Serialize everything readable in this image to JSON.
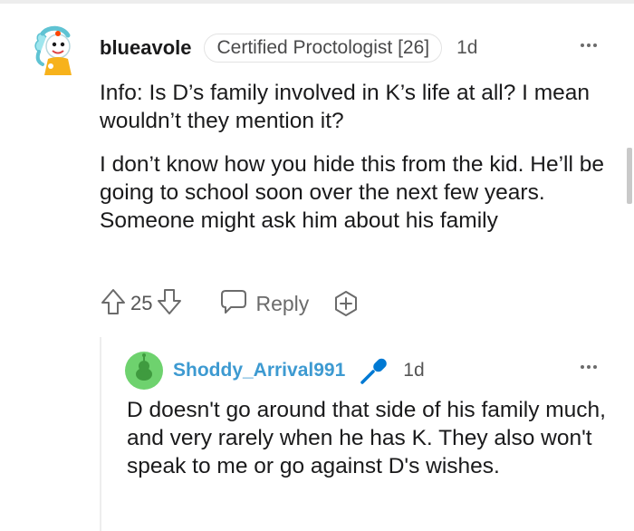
{
  "comment": {
    "username": "blueavole",
    "flair": "Certified Proctologist [26]",
    "time": "1d",
    "paragraphs": [
      "Info: Is D’s family involved in K’s life at all? I mean wouldn’t they mention it?",
      "I don’t know how you hide this from the kid. He’ll be going to school soon over the next few years. Someone might ask him about his family"
    ],
    "actions": {
      "vote_count": "25",
      "reply_label": "Reply"
    }
  },
  "reply": {
    "username": "Shoddy_Arrival991",
    "time": "1d",
    "text": "D doesn't go around that side of his family much, and very rarely when he has K. They also won't speak to me or go against D's wishes."
  },
  "icons": {
    "comment_avatar": "avatar-character-icon",
    "reply_avatar": "avatar-green-alien-icon",
    "upvote": "upvote-arrow-icon",
    "downvote": "downvote-arrow-icon",
    "reply": "speech-bubble-icon",
    "award": "award-plus-icon",
    "op_badge": "microphone-icon",
    "more": "more-options-icon"
  },
  "colors": {
    "username_link": "#3d9ad1",
    "mod_badge": "#0079d3",
    "avatar_green": "#6ed26e",
    "meta_gray": "#6b6b6b"
  }
}
